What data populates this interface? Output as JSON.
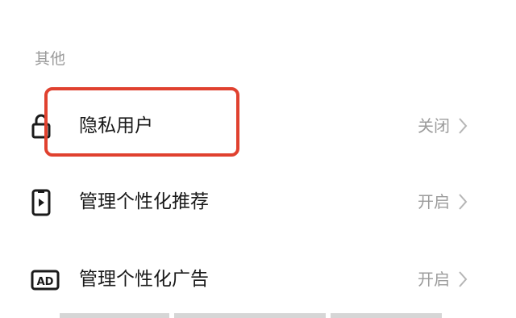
{
  "section": {
    "title": "其他"
  },
  "rows": [
    {
      "label": "隐私用户",
      "value": "关闭",
      "icon": "lock-icon"
    },
    {
      "label": "管理个性化推荐",
      "value": "开启",
      "icon": "phone-play-icon"
    },
    {
      "label": "管理个性化广告",
      "value": "开启",
      "icon": "ad-icon"
    }
  ],
  "colors": {
    "highlight": "#e0412f",
    "text_primary": "#1a1a1a",
    "text_secondary": "#9c9c9c"
  }
}
